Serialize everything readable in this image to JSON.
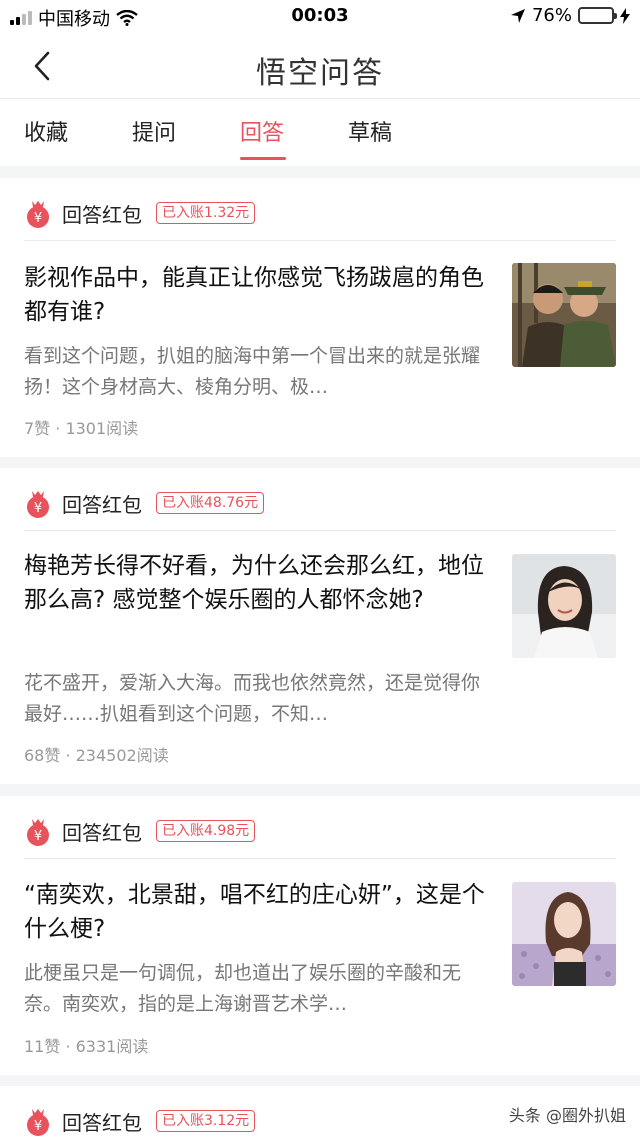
{
  "status_bar": {
    "carrier": "中国移动",
    "time": "00:03",
    "battery": "76%",
    "battery_level": 0.76
  },
  "nav": {
    "title": "悟空问答",
    "back_icon": "chevron-left-icon"
  },
  "tabs": [
    {
      "label": "收藏",
      "active": false
    },
    {
      "label": "提问",
      "active": false
    },
    {
      "label": "回答",
      "active": true
    },
    {
      "label": "草稿",
      "active": false
    }
  ],
  "accent_color": "#e8525c",
  "cards": [
    {
      "hongbao_label": "回答红包",
      "badge": "已入账1.32元",
      "title": "影视作品中，能真正让你感觉飞扬跋扈的角色都有谁?",
      "excerpt": "看到这个问题，扒姐的脑海中第一个冒出来的就是张耀扬！这个身材高大、棱角分明、极…",
      "meta": "7赞 · 1301阅读"
    },
    {
      "hongbao_label": "回答红包",
      "badge": "已入账48.76元",
      "title": "梅艳芳长得不好看，为什么还会那么红，地位那么高? 感觉整个娱乐圈的人都怀念她?",
      "excerpt": "花不盛开，爱渐入大海。而我也依然竟然，还是觉得你最好……扒姐看到这个问题，不知…",
      "meta": "68赞 · 234502阅读"
    },
    {
      "hongbao_label": "回答红包",
      "badge": "已入账4.98元",
      "title": "“南奕欢，北景甜，唱不红的庄心妍”，这是个什么梗?",
      "excerpt": "此梗虽只是一句调侃，却也道出了娱乐圈的辛酸和无奈。南奕欢，指的是上海谢晋艺术学…",
      "meta": "11赞 · 6331阅读"
    },
    {
      "hongbao_label": "回答红包",
      "badge": "已入账3.12元"
    }
  ],
  "watermark": "头条 @圈外扒姐"
}
